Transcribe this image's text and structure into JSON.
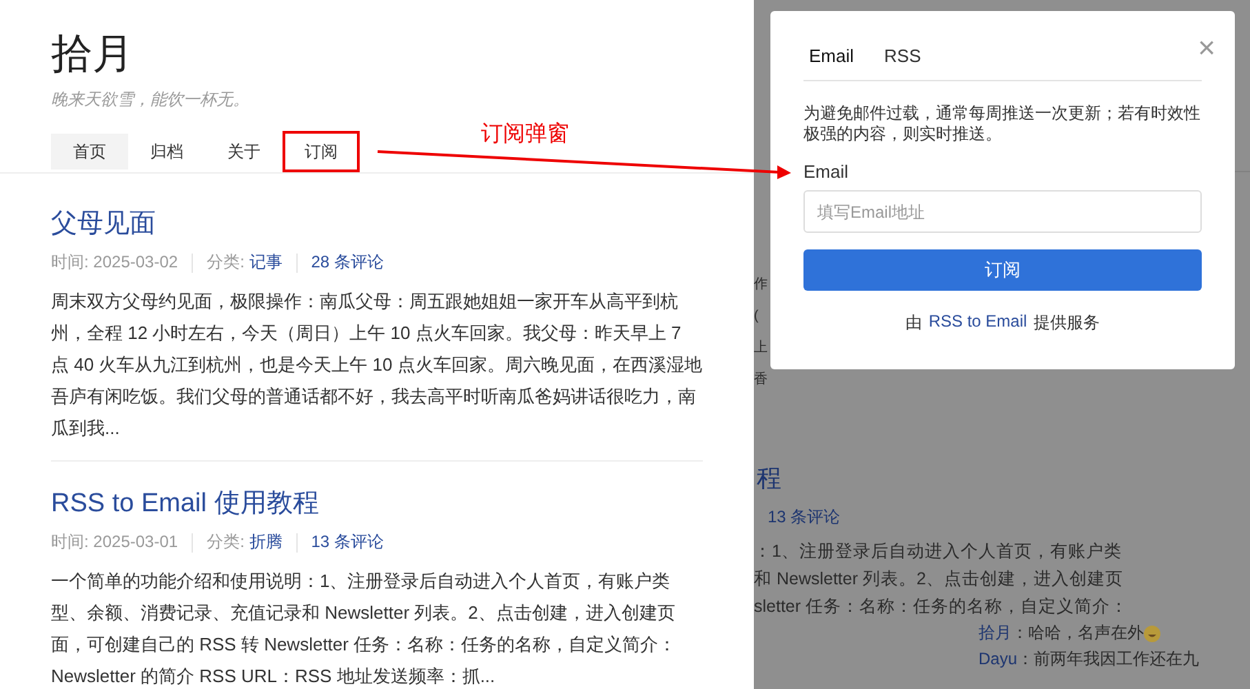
{
  "site": {
    "title": "拾月",
    "subtitle": "晚来天欲雪，能饮一杯无。"
  },
  "nav": [
    {
      "label": "首页",
      "selected": true,
      "highlighted": false
    },
    {
      "label": "归档",
      "selected": false,
      "highlighted": false
    },
    {
      "label": "关于",
      "selected": false,
      "highlighted": false
    },
    {
      "label": "订阅",
      "selected": false,
      "highlighted": true
    }
  ],
  "annotation": {
    "label": "订阅弹窗"
  },
  "posts": [
    {
      "title": "父母见面",
      "date": "时间: 2025-03-02",
      "category_label": "分类:",
      "category": "记事",
      "comments": "28 条评论",
      "excerpt": "周末双方父母约见面，极限操作：南瓜父母：周五跟她姐姐一家开车从高平到杭州，全程 12 小时左右，今天（周日）上午 10 点火车回家。我父母：昨天早上 7 点 40 火车从九江到杭州，也是今天上午 10 点火车回家。周六晚见面，在西溪湿地吾庐有闲吃饭。我们父母的普通话都不好，我去高平时听南瓜爸妈讲话很吃力，南瓜到我..."
    },
    {
      "title": "RSS to Email 使用教程",
      "date": "时间: 2025-03-01",
      "category_label": "分类:",
      "category": "折腾",
      "comments": "13 条评论",
      "excerpt": "一个简单的功能介绍和使用说明：1、注册登录后自动进入个人首页，有账户类型、余额、消费记录、充值记录和 Newsletter 列表。2、点击创建，进入创建页面，可创建自己的 RSS 转 Newsletter 任务：名称：任务的名称，自定义简介：Newsletter 的简介 RSS URL：RSS 地址发送频率：抓..."
    }
  ],
  "backdrop": {
    "fragments": [
      "作",
      "(",
      "上",
      "香"
    ],
    "title": "程",
    "comments": "13 条评论",
    "lines": [
      "：1、注册登录后自动进入个人首页，有账户类",
      "和 Newsletter 列表。2、点击创建，进入创建页",
      "sletter 任务：名称：任务的名称，自定义简介："
    ],
    "replies": [
      {
        "author": "拾月",
        "text": "：哈哈，名声在外"
      },
      {
        "author": "Dayu",
        "text": "：前两年我因工作还在九"
      }
    ]
  },
  "dialog": {
    "tabs": [
      {
        "label": "Email",
        "selected": true
      },
      {
        "label": "RSS",
        "selected": false
      }
    ],
    "close": "×",
    "description": "为避免邮件过载，通常每周推送一次更新；若有时效性极强的内容，则实时推送。",
    "field_label": "Email",
    "placeholder": "填写Email地址",
    "button": "订阅",
    "footer_before": "由",
    "footer_link": "RSS to Email",
    "footer_after": "提供服务"
  }
}
